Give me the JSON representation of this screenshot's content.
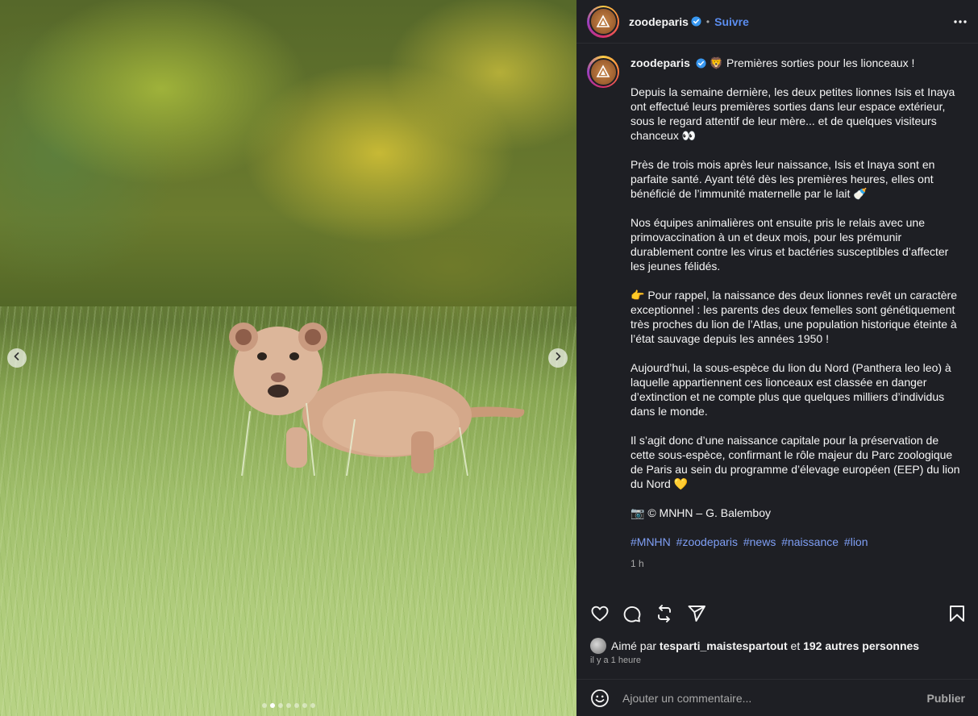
{
  "post": {
    "account": "zoodeparis",
    "follow_label": "Suivre",
    "separator": "•",
    "caption": {
      "title": "🦁 Premières sorties pour les lionceaux !",
      "paragraphs": [
        "Depuis la semaine dernière, les deux petites lionnes Isis et Inaya ont effectué leurs premières sorties dans leur espace extérieur, sous le regard attentif de leur mère... et de quelques visiteurs chanceux 👀",
        "Près de trois mois après leur naissance, Isis et Inaya sont en parfaite santé. Ayant tété dès les premières heures, elles ont bénéficié de l’immunité maternelle par le lait 🍼",
        "Nos équipes animalières ont ensuite pris le relais avec une primovaccination à un et deux mois, pour les prémunir durablement contre les virus et bactéries susceptibles d’affecter les jeunes félidés.",
        "👉 Pour rappel, la naissance des deux lionnes revêt un caractère exceptionnel : les parents des deux femelles sont génétiquement très proches du lion de l’Atlas, une population historique éteinte à l’état sauvage depuis les années 1950 !",
        "Aujourd’hui, la sous-espèce du lion du Nord (Panthera leo leo) à laquelle appartiennent ces lionceaux est classée en danger d’extinction et ne compte plus que quelques milliers d’individus dans le monde.",
        "Il s’agit donc d’une naissance capitale pour la préservation de cette sous-espèce, confirmant le rôle majeur du Parc zoologique de Paris au sein du programme d’élevage européen (EEP) du lion du Nord 💛",
        "📷 © MNHN – G. Balemboy"
      ],
      "hashtags": [
        "#MNHN",
        "#zoodeparis",
        "#news",
        "#naissance",
        "#lion"
      ],
      "time": "1 h"
    },
    "likes": {
      "prefix": "Aimé par",
      "user": "tesparti_maistespartout",
      "joiner": "et",
      "others": "192 autres personnes"
    },
    "posted_ago": "il y a 1 heure",
    "comment": {
      "placeholder": "Ajouter un commentaire...",
      "publish_label": "Publier"
    },
    "carousel": {
      "slide_count": 7,
      "active_index": 1
    }
  },
  "icons": {
    "more": "more-horizontal-icon",
    "like": "heart-icon",
    "comment": "comment-icon",
    "repost": "repost-icon",
    "share": "share-icon",
    "save": "bookmark-icon",
    "emoji": "emoji-icon",
    "verified": "verified-badge-icon",
    "prev": "chevron-left-icon",
    "next": "chevron-right-icon"
  },
  "colors": {
    "panel_bg": "#1e1f24",
    "link_blue": "#5b8def",
    "hashtag_blue": "#7f9ff5",
    "muted": "#a8a8a8"
  }
}
